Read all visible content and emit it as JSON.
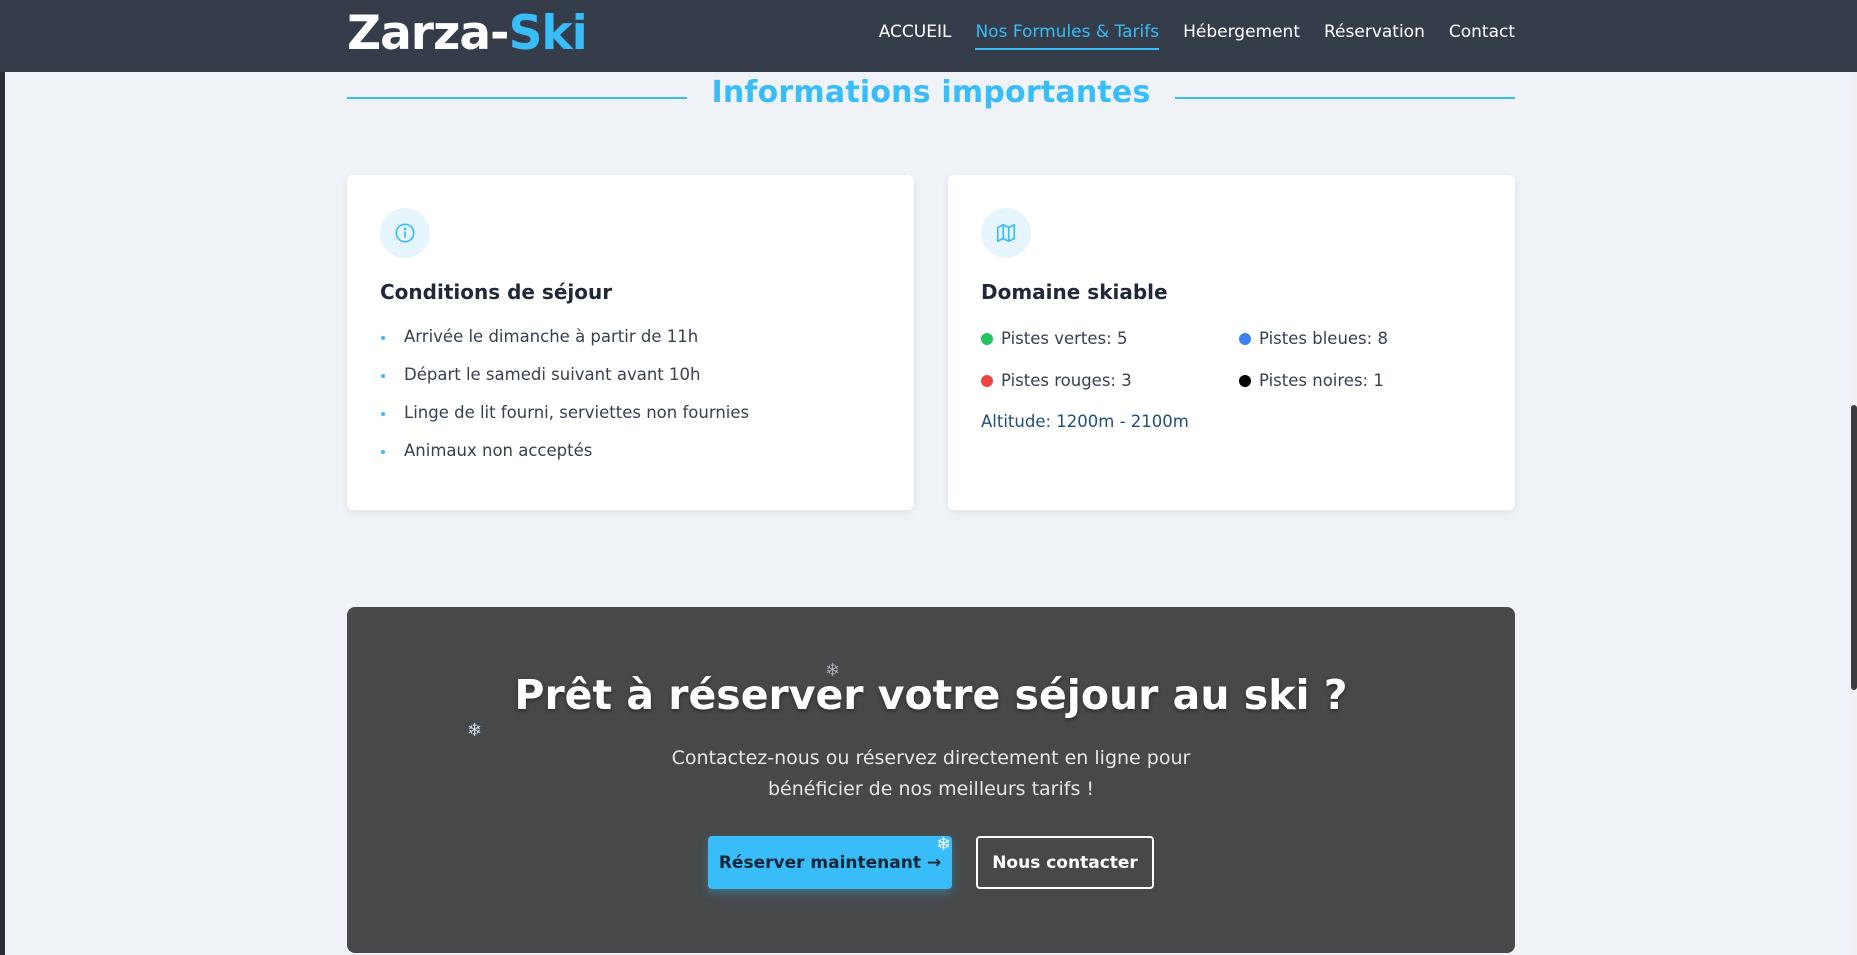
{
  "header": {
    "logo_main": "Zarza-",
    "logo_accent": "Ski",
    "nav": [
      {
        "label": "ACCUEIL"
      },
      {
        "label": "Nos Formules & Tarifs",
        "active": true
      },
      {
        "label": "Hébergement"
      },
      {
        "label": "Réservation"
      },
      {
        "label": "Contact"
      }
    ]
  },
  "section": {
    "title": "Informations importantes"
  },
  "conditions": {
    "icon": "info-icon",
    "title": "Conditions de séjour",
    "items": [
      "Arrivée le dimanche à partir de 11h",
      "Départ le samedi suivant avant 10h",
      "Linge de lit fourni, serviettes non fournies",
      "Animaux non acceptés"
    ]
  },
  "domaine": {
    "icon": "map-icon",
    "title": "Domaine skiable",
    "pistes": [
      {
        "label": "Pistes vertes: 5",
        "color": "#22c55e"
      },
      {
        "label": "Pistes bleues: 8",
        "color": "#3b82f6"
      },
      {
        "label": "Pistes rouges: 3",
        "color": "#ef4444"
      },
      {
        "label": "Pistes noires: 1",
        "color": "#000000"
      }
    ],
    "altitude": "Altitude: 1200m - 2100m"
  },
  "cta": {
    "title": "Prêt à réserver votre séjour au ski ?",
    "text_line1": "Contactez-nous ou réservez directement en ligne pour",
    "text_line2": "bénéficier de nos meilleurs tarifs !",
    "primary_button": "Réserver maintenant →",
    "secondary_button": "Nous contacter",
    "snowflake": "❄"
  },
  "colors": {
    "accent": "#38bdf8",
    "header_bg": "#353d4a",
    "cta_bg": "#464849",
    "page_bg": "#eff3f7"
  }
}
